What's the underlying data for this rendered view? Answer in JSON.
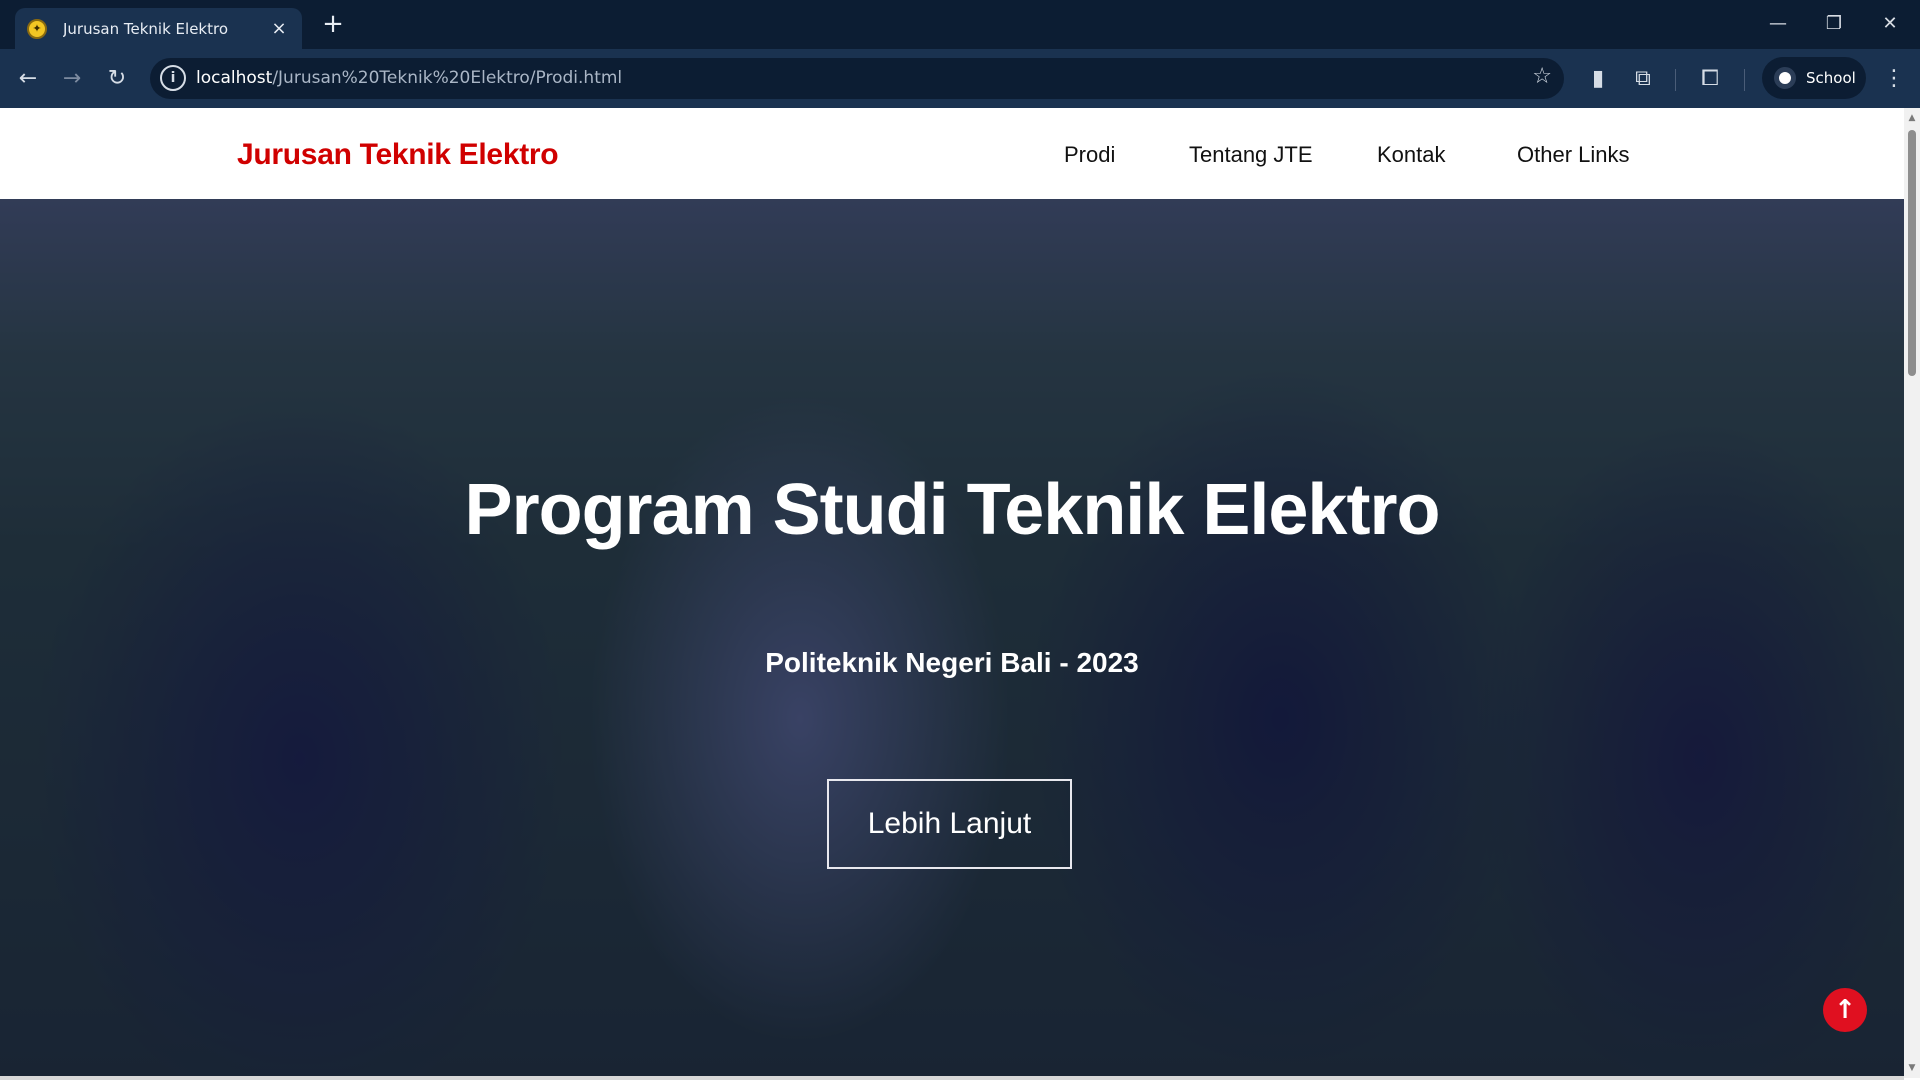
{
  "browser": {
    "tab": {
      "title": "Jurusan Teknik Elektro",
      "close_icon": "×"
    },
    "new_tab_icon": "+",
    "window_controls": {
      "minimize": "—",
      "restore": "❐",
      "close": "✕"
    },
    "nav_icons": {
      "back": "←",
      "forward": "→",
      "reload": "↻"
    },
    "address": {
      "host": "localhost",
      "path": "/Jurusan%20Teknik%20Elektro/Prodi.html"
    },
    "profile": {
      "name": "School"
    },
    "icons": [
      "info-icon",
      "star-icon",
      "files-icon",
      "extensions-icon",
      "cast-search-icon",
      "menu-dots-icon"
    ]
  },
  "site": {
    "brand": "Jurusan Teknik Elektro",
    "brand_color": "#d00000",
    "nav": [
      {
        "label": "Prodi"
      },
      {
        "label": "Tentang JTE"
      },
      {
        "label": "Kontak"
      },
      {
        "label": "Other Links"
      }
    ]
  },
  "hero": {
    "title": "Program Studi Teknik Elektro",
    "subtitle": "Politeknik Negeri Bali - 2023",
    "button_label": "Lebih Lanjut",
    "back_to_top_icon": "↑",
    "accent_color": "#e01020"
  }
}
